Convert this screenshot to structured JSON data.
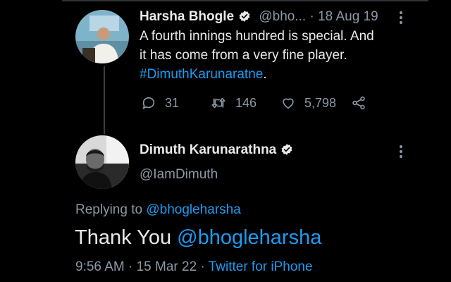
{
  "parent": {
    "name": "Harsha Bhogle",
    "handle": "@bho...",
    "separator": "·",
    "date": "18 Aug 19",
    "text_line1": "A fourth innings hundred is special. And",
    "text_line2": "it has come from a very fine player.",
    "hashtag": "#DimuthKarunaratne",
    "hashtag_suffix": ".",
    "replies": "31",
    "retweets": "146",
    "likes": "5,798"
  },
  "reply": {
    "name": "Dimuth Karunarathna",
    "handle": "@IamDimuth",
    "replying_prefix": "Replying to",
    "replying_to": "@bhogleharsha",
    "text_main": "Thank You",
    "text_mention": "@bhogleharsha",
    "time": "9:56 AM",
    "separator": "·",
    "date": "15 Mar 22",
    "source_separator": "·",
    "source": "Twitter for iPhone"
  },
  "colors": {
    "background": "#000000",
    "text": "#e7e9ea",
    "muted": "#8b98a5",
    "link": "#1d9bf0"
  },
  "icons": {
    "verified": "verified-badge-icon",
    "more": "more-vertical-icon",
    "reply": "reply-bubble-icon",
    "retweet": "retweet-icon",
    "like": "heart-icon",
    "share": "share-icon"
  }
}
